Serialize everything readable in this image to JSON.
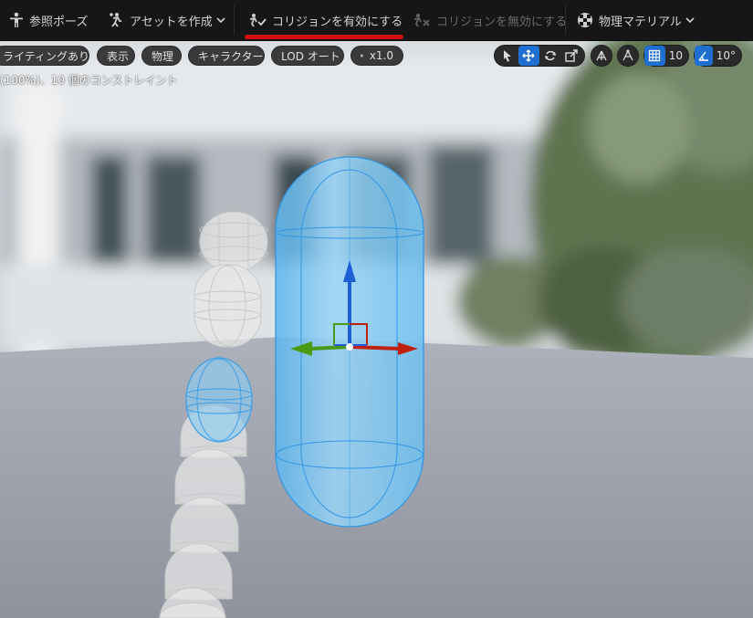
{
  "toolbar": {
    "reference_pose": "参照ポーズ",
    "create_asset": "アセットを作成",
    "enable_collision": "コリジョンを有効にする",
    "disable_collision": "コリジョンを無効にする",
    "physics_material": "物理マテリアル"
  },
  "viewport": {
    "buttons": {
      "lighting": "ライティングあり",
      "show": "表示",
      "physics": "物理",
      "character": "キャラクター",
      "lod": "LOD オート",
      "play_speed": "x1.0"
    },
    "status_text": "(100%)、10 個のコンストレイント",
    "grid_snap": "10",
    "rotation_snap": "10°"
  },
  "colors": {
    "accent": "#1f6fd1",
    "highlight_underline": "#d40f10",
    "gizmo_z": "#1f5fd6",
    "gizmo_x": "#c2200e",
    "gizmo_y": "#4a9a16"
  }
}
